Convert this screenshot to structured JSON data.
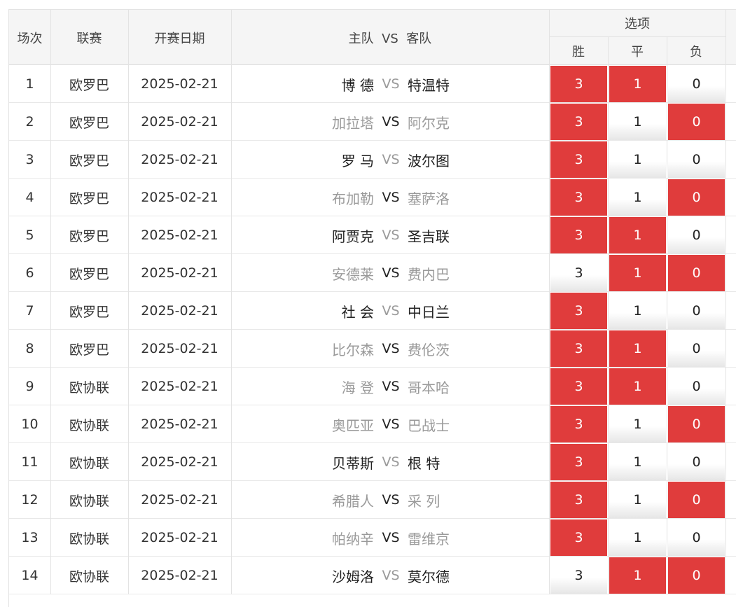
{
  "header": {
    "col_index": "场次",
    "col_league": "联赛",
    "col_date": "开赛日期",
    "col_match": "主队  VS  客队",
    "options_title": "选项",
    "opt_win": "胜",
    "opt_draw": "平",
    "opt_lose": "负"
  },
  "vs_text": "VS",
  "option_values": [
    "3",
    "1",
    "0"
  ],
  "colors": {
    "selected_bg": "#e03c3c",
    "header_bg": "#f5f5f5",
    "muted_text": "#9a9a9a"
  },
  "rows": [
    {
      "no": "1",
      "league": "欧罗巴",
      "date": "2025-02-21",
      "home": "博 德",
      "away": "特温特",
      "home_muted": false,
      "vs_muted": true,
      "away_muted": false,
      "win": true,
      "draw": true,
      "lose": false
    },
    {
      "no": "2",
      "league": "欧罗巴",
      "date": "2025-02-21",
      "home": "加拉塔",
      "away": "阿尔克",
      "home_muted": true,
      "vs_muted": false,
      "away_muted": true,
      "win": true,
      "draw": false,
      "lose": true
    },
    {
      "no": "3",
      "league": "欧罗巴",
      "date": "2025-02-21",
      "home": "罗 马",
      "away": "波尔图",
      "home_muted": false,
      "vs_muted": true,
      "away_muted": false,
      "win": true,
      "draw": false,
      "lose": false
    },
    {
      "no": "4",
      "league": "欧罗巴",
      "date": "2025-02-21",
      "home": "布加勒",
      "away": "塞萨洛",
      "home_muted": true,
      "vs_muted": false,
      "away_muted": true,
      "win": true,
      "draw": false,
      "lose": true
    },
    {
      "no": "5",
      "league": "欧罗巴",
      "date": "2025-02-21",
      "home": "阿贾克",
      "away": "圣吉联",
      "home_muted": false,
      "vs_muted": true,
      "away_muted": false,
      "win": true,
      "draw": true,
      "lose": false
    },
    {
      "no": "6",
      "league": "欧罗巴",
      "date": "2025-02-21",
      "home": "安德莱",
      "away": "费内巴",
      "home_muted": true,
      "vs_muted": false,
      "away_muted": true,
      "win": false,
      "draw": true,
      "lose": true
    },
    {
      "no": "7",
      "league": "欧罗巴",
      "date": "2025-02-21",
      "home": "社 会",
      "away": "中日兰",
      "home_muted": false,
      "vs_muted": true,
      "away_muted": false,
      "win": true,
      "draw": false,
      "lose": false
    },
    {
      "no": "8",
      "league": "欧罗巴",
      "date": "2025-02-21",
      "home": "比尔森",
      "away": "费伦茨",
      "home_muted": true,
      "vs_muted": false,
      "away_muted": true,
      "win": true,
      "draw": true,
      "lose": false
    },
    {
      "no": "9",
      "league": "欧协联",
      "date": "2025-02-21",
      "home": "海 登",
      "away": "哥本哈",
      "home_muted": true,
      "vs_muted": false,
      "away_muted": true,
      "win": true,
      "draw": true,
      "lose": false
    },
    {
      "no": "10",
      "league": "欧协联",
      "date": "2025-02-21",
      "home": "奥匹亚",
      "away": "巴战士",
      "home_muted": true,
      "vs_muted": false,
      "away_muted": true,
      "win": true,
      "draw": false,
      "lose": true
    },
    {
      "no": "11",
      "league": "欧协联",
      "date": "2025-02-21",
      "home": "贝蒂斯",
      "away": "根 特",
      "home_muted": false,
      "vs_muted": true,
      "away_muted": false,
      "win": true,
      "draw": false,
      "lose": false
    },
    {
      "no": "12",
      "league": "欧协联",
      "date": "2025-02-21",
      "home": "希腊人",
      "away": "采 列",
      "home_muted": true,
      "vs_muted": false,
      "away_muted": true,
      "win": true,
      "draw": false,
      "lose": true
    },
    {
      "no": "13",
      "league": "欧协联",
      "date": "2025-02-21",
      "home": "帕纳辛",
      "away": "雷维京",
      "home_muted": true,
      "vs_muted": false,
      "away_muted": true,
      "win": true,
      "draw": false,
      "lose": false
    },
    {
      "no": "14",
      "league": "欧协联",
      "date": "2025-02-21",
      "home": "沙姆洛",
      "away": "莫尔德",
      "home_muted": false,
      "vs_muted": true,
      "away_muted": false,
      "win": false,
      "draw": true,
      "lose": true
    }
  ]
}
